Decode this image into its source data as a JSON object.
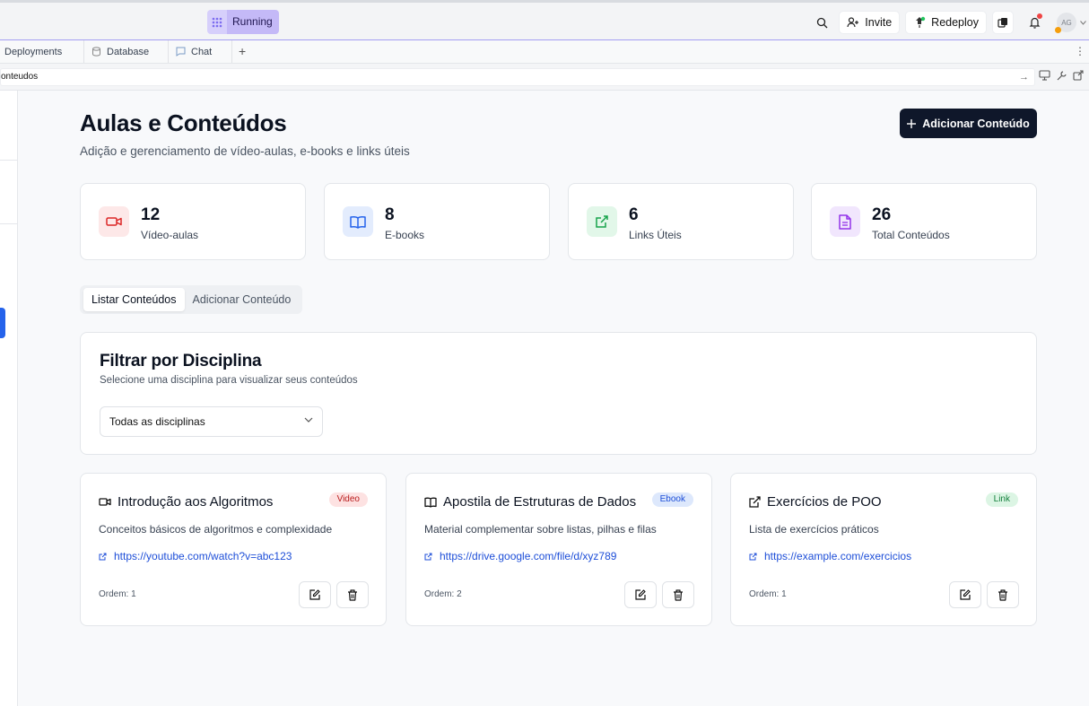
{
  "topbar": {
    "status": "Running",
    "invite": "Invite",
    "redeploy": "Redeploy",
    "avatar": "AG"
  },
  "tabs_strip": [
    {
      "label": "Deployments"
    },
    {
      "label": "Database"
    },
    {
      "label": "Chat"
    }
  ],
  "address": "onteudos",
  "page": {
    "title": "Aulas e Conteúdos",
    "subtitle": "Adição e gerenciamento de vídeo-aulas, e-books e links úteis",
    "add_button": "Adicionar Conteúdo"
  },
  "stats": [
    {
      "value": "12",
      "label": "Vídeo-aulas",
      "icon": "video-icon",
      "color": "#dc2626",
      "bg": "#fde8e8"
    },
    {
      "value": "8",
      "label": "E-books",
      "icon": "book-icon",
      "color": "#2563eb",
      "bg": "#e3ecfd"
    },
    {
      "value": "6",
      "label": "Links Úteis",
      "icon": "external-link-icon",
      "color": "#16a34a",
      "bg": "#e2f7e9"
    },
    {
      "value": "26",
      "label": "Total Conteúdos",
      "icon": "file-text-icon",
      "color": "#9333ea",
      "bg": "#f1e6fd"
    }
  ],
  "content_tabs": [
    "Listar Conteúdos",
    "Adicionar Conteúdo"
  ],
  "filter": {
    "title": "Filtrar por Disciplina",
    "subtitle": "Selecione uma disciplina para visualizar seus conteúdos",
    "selected": "Todas as disciplinas"
  },
  "cards": [
    {
      "title": "Introdução aos Algoritmos",
      "badge": "Video",
      "badge_bg": "#fde2e2",
      "badge_color": "#b91c1c",
      "desc": "Conceitos básicos de algoritmos e complexidade",
      "url": "https://youtube.com/watch?v=abc123",
      "order": "Ordem: 1",
      "icon": "video-icon"
    },
    {
      "title": "Apostila de Estruturas de Dados",
      "badge": "Ebook",
      "badge_bg": "#dde8fc",
      "badge_color": "#1d4ed8",
      "desc": "Material complementar sobre listas, pilhas e filas",
      "url": "https://drive.google.com/file/d/xyz789",
      "order": "Ordem: 2",
      "icon": "book-icon"
    },
    {
      "title": "Exercícios de POO",
      "badge": "Link",
      "badge_bg": "#dcf5e4",
      "badge_color": "#15803d",
      "desc": "Lista de exercícios práticos",
      "url": "https://example.com/exercicios",
      "order": "Ordem: 1",
      "icon": "external-link-icon"
    }
  ]
}
